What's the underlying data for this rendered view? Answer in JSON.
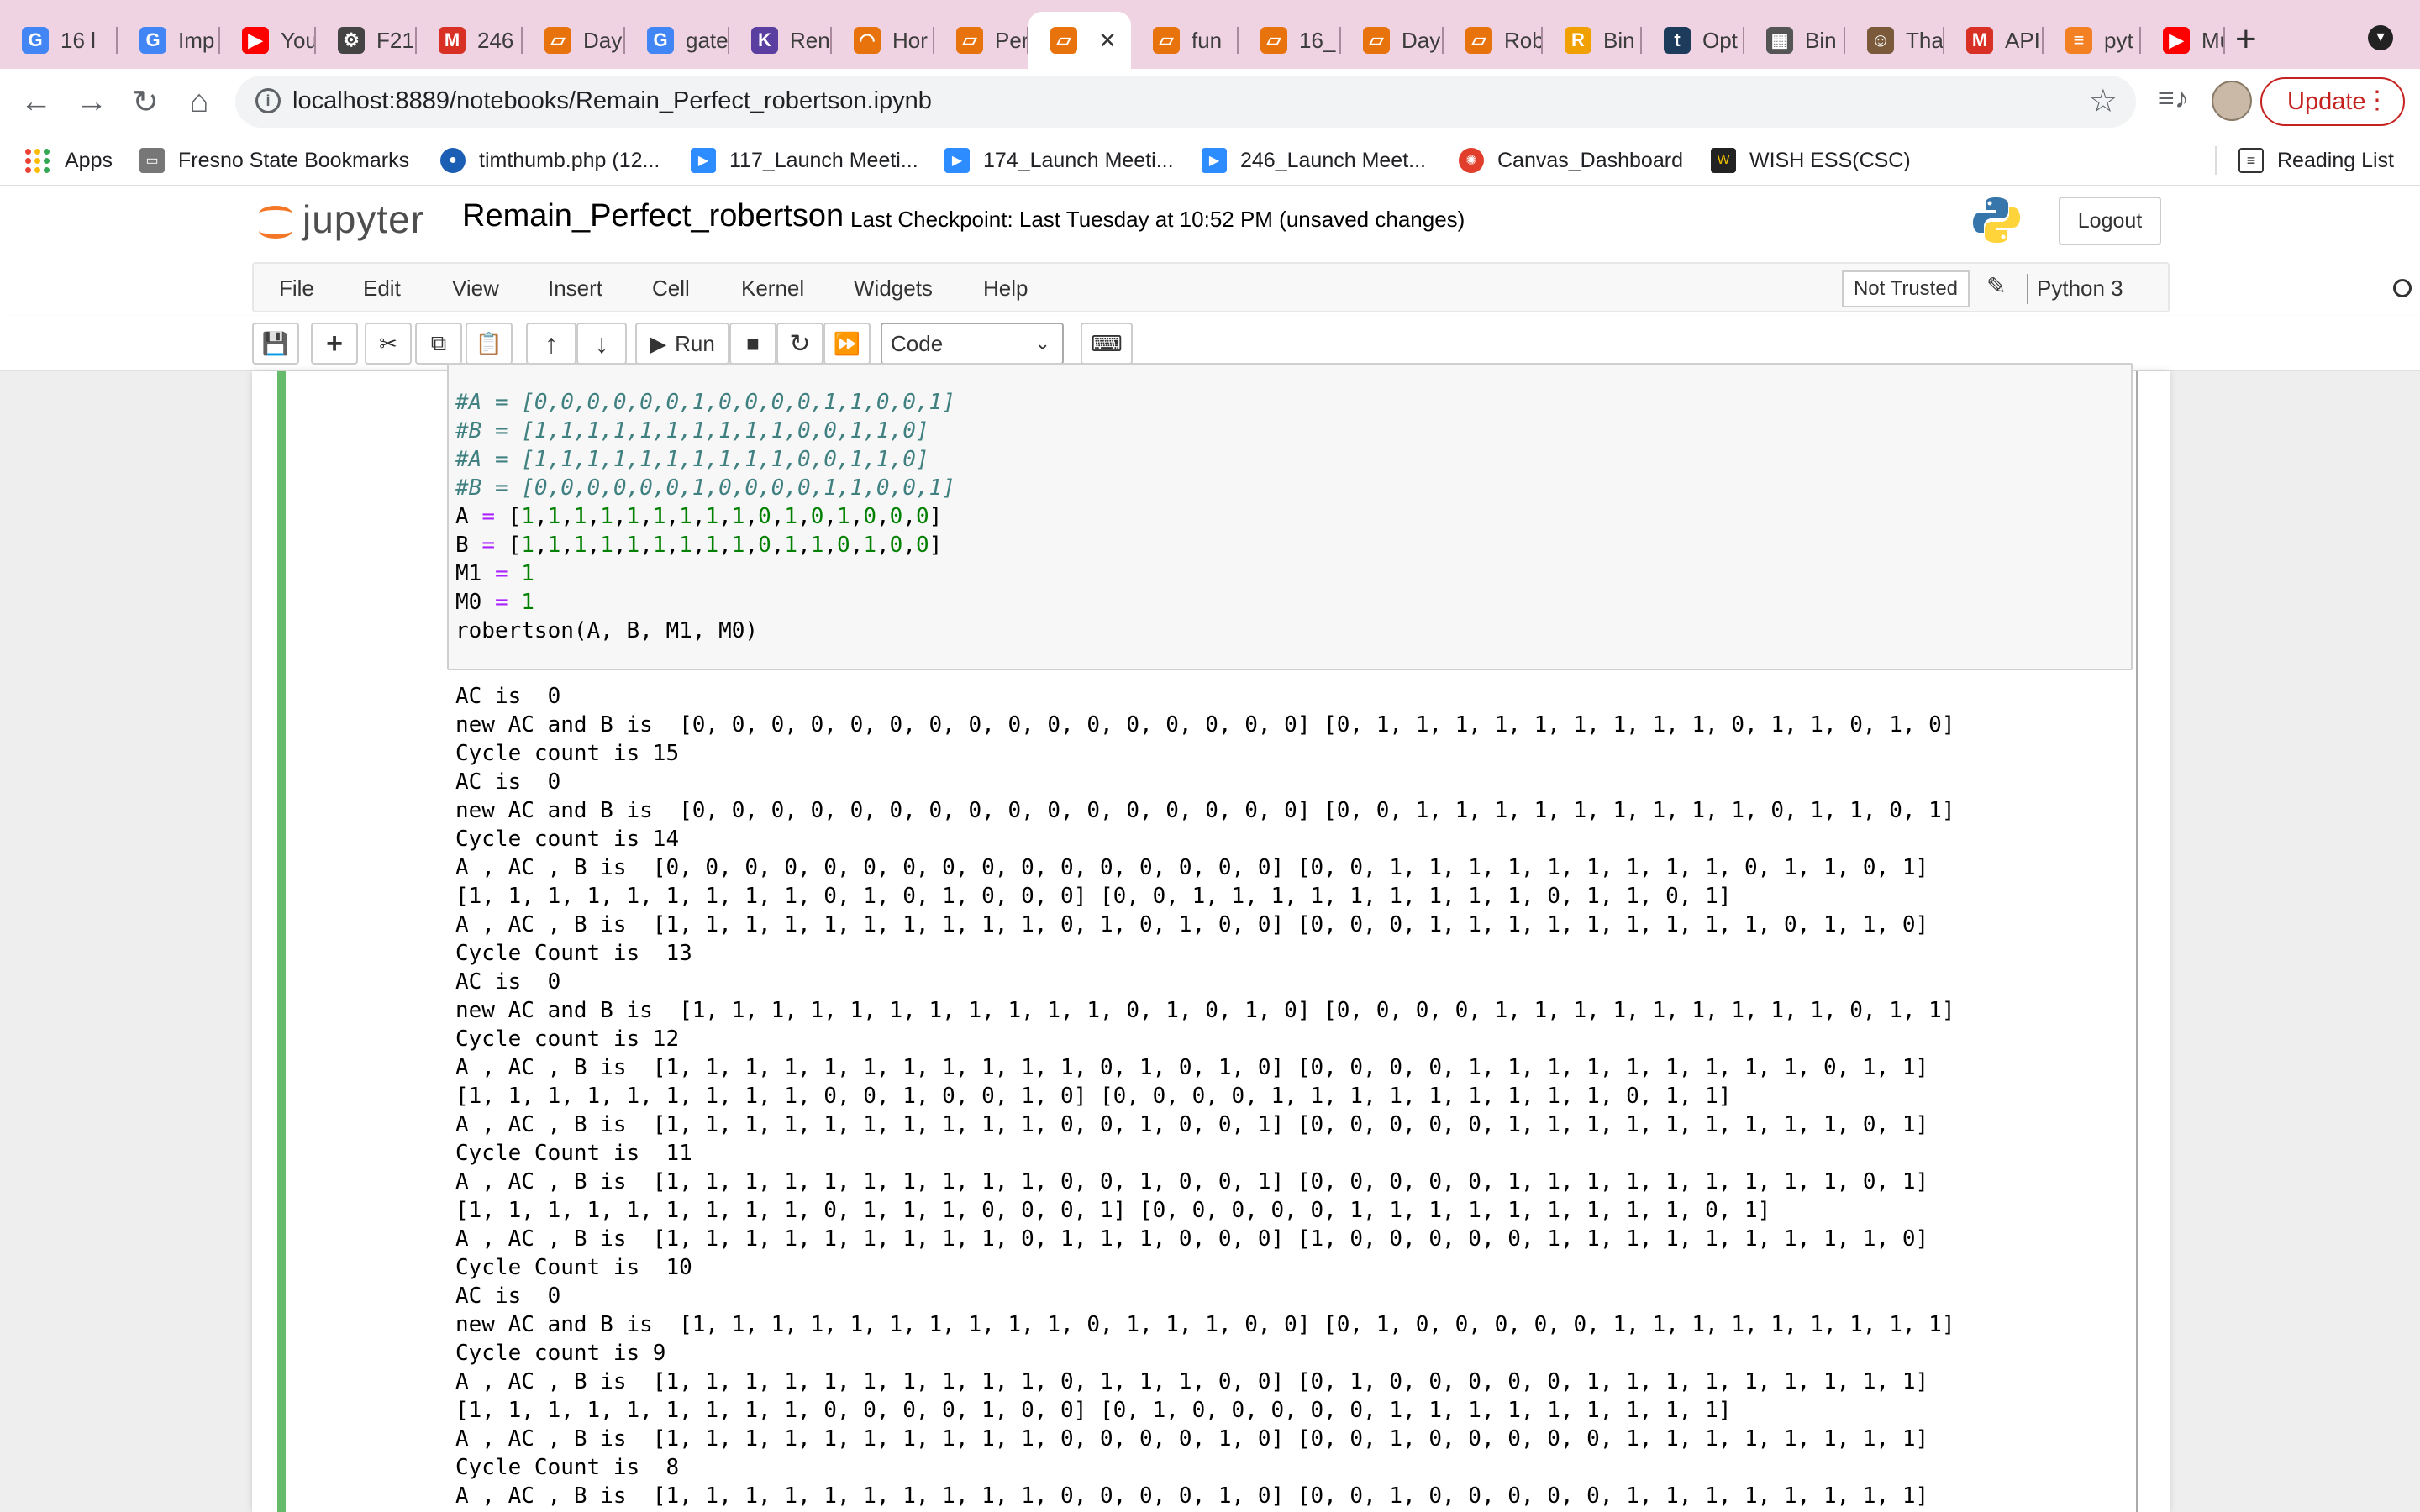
{
  "browser": {
    "tabs": [
      {
        "label": "16 l",
        "icon": "google-icon",
        "color": "#4285f4",
        "glyph": "G"
      },
      {
        "label": "Imp",
        "icon": "google-icon",
        "color": "#4285f4",
        "glyph": "G"
      },
      {
        "label": "You",
        "icon": "youtube-icon",
        "color": "#ff0000",
        "glyph": "▶"
      },
      {
        "label": "F21",
        "icon": "atom-icon",
        "color": "#444444",
        "glyph": "⚙"
      },
      {
        "label": "246",
        "icon": "gmail-icon",
        "color": "#d93025",
        "glyph": "M"
      },
      {
        "label": "Day",
        "icon": "book-icon",
        "color": "#e8730c",
        "glyph": "▱"
      },
      {
        "label": "gate",
        "icon": "google-icon",
        "color": "#4285f4",
        "glyph": "G"
      },
      {
        "label": "Ren",
        "icon": "kp-icon",
        "color": "#5a3fa0",
        "glyph": "K"
      },
      {
        "label": "Hor",
        "icon": "loading-icon",
        "color": "#e8730c",
        "glyph": "◠"
      },
      {
        "label": "Per",
        "icon": "book-icon",
        "color": "#e8730c",
        "glyph": "▱"
      },
      {
        "label": "",
        "icon": "book-icon",
        "color": "#e8730c",
        "glyph": "▱"
      },
      {
        "label": "fun",
        "icon": "book-icon",
        "color": "#e8730c",
        "glyph": "▱"
      },
      {
        "label": "16_",
        "icon": "book-icon",
        "color": "#e8730c",
        "glyph": "▱"
      },
      {
        "label": "Day",
        "icon": "book-icon",
        "color": "#e8730c",
        "glyph": "▱"
      },
      {
        "label": "Rob",
        "icon": "book-icon",
        "color": "#e8730c",
        "glyph": "▱"
      },
      {
        "label": "Bin",
        "icon": "r-icon",
        "color": "#f0a000",
        "glyph": "R"
      },
      {
        "label": "Opt",
        "icon": "tds-icon",
        "color": "#1d3c5c",
        "glyph": "t"
      },
      {
        "label": "Bin",
        "icon": "calculator-icon",
        "color": "#555555",
        "glyph": "▦"
      },
      {
        "label": "Tha",
        "icon": "avatar-icon",
        "color": "#7a5a3a",
        "glyph": "☺"
      },
      {
        "label": "API",
        "icon": "gmail-icon",
        "color": "#d93025",
        "glyph": "M"
      },
      {
        "label": "pyt",
        "icon": "stack-icon",
        "color": "#f48024",
        "glyph": "≡"
      },
      {
        "label": "Mu",
        "icon": "youtube-icon",
        "color": "#ff0000",
        "glyph": "▶"
      }
    ],
    "url": "localhost:8889/notebooks/Remain_Perfect_robertson.ipynb",
    "update_label": "Update",
    "bookmarks": [
      {
        "label": "Apps",
        "icon": "apps-grid-icon"
      },
      {
        "label": "Fresno State Bookmarks",
        "icon": "folder-icon"
      },
      {
        "label": "timthumb.php (12...",
        "icon": "globe-icon"
      },
      {
        "label": "117_Launch Meeti...",
        "icon": "zoom-icon"
      },
      {
        "label": "174_Launch Meeti...",
        "icon": "zoom-icon"
      },
      {
        "label": "246_Launch Meet...",
        "icon": "zoom-icon"
      },
      {
        "label": "Canvas_Dashboard",
        "icon": "canvas-icon"
      },
      {
        "label": "WISH ESS(CSC)",
        "icon": "wish-icon"
      }
    ],
    "reading_list": "Reading List"
  },
  "jupyter": {
    "logo_text": "jupyter",
    "notebook_name": "Remain_Perfect_robertson",
    "checkpoint": "Last Checkpoint: Last Tuesday at 10:52 PM  (unsaved changes)",
    "logout": "Logout",
    "menus": [
      "File",
      "Edit",
      "View",
      "Insert",
      "Cell",
      "Kernel",
      "Widgets",
      "Help"
    ],
    "trust": "Not Trusted",
    "kernel": "Python 3",
    "run_label": "Run",
    "cell_type": "Code"
  },
  "cell": {
    "code_lines": [
      {
        "text": "#A = [0,0,0,0,0,0,1,0,0,0,0,1,1,0,0,1]",
        "kind": "comment"
      },
      {
        "text": "#B = [1,1,1,1,1,1,1,1,1,1,0,0,1,1,0]",
        "kind": "comment"
      },
      {
        "text": "#A = [1,1,1,1,1,1,1,1,1,1,0,0,1,1,0]",
        "kind": "comment"
      },
      {
        "text": "#B = [0,0,0,0,0,0,1,0,0,0,0,1,1,0,0,1]",
        "kind": "comment"
      },
      {
        "text": "A = [1,1,1,1,1,1,1,1,1,0,1,0,1,0,0,0]",
        "kind": "assign"
      },
      {
        "text": "B = [1,1,1,1,1,1,1,1,1,0,1,1,0,1,0,0]",
        "kind": "assign"
      },
      {
        "text": "M1 = 1",
        "kind": "assign"
      },
      {
        "text": "M0 = 1",
        "kind": "assign"
      },
      {
        "text": "robertson(A, B, M1, M0)",
        "kind": "plain"
      }
    ],
    "output_lines": [
      "AC is  0",
      "new AC and B is  [0, 0, 0, 0, 0, 0, 0, 0, 0, 0, 0, 0, 0, 0, 0, 0] [0, 1, 1, 1, 1, 1, 1, 1, 1, 1, 0, 1, 1, 0, 1, 0]",
      "Cycle count is 15",
      "AC is  0",
      "new AC and B is  [0, 0, 0, 0, 0, 0, 0, 0, 0, 0, 0, 0, 0, 0, 0, 0] [0, 0, 1, 1, 1, 1, 1, 1, 1, 1, 1, 0, 1, 1, 0, 1]",
      "Cycle count is 14",
      "A , AC , B is  [0, 0, 0, 0, 0, 0, 0, 0, 0, 0, 0, 0, 0, 0, 0, 0] [0, 0, 1, 1, 1, 1, 1, 1, 1, 1, 1, 0, 1, 1, 0, 1]",
      "[1, 1, 1, 1, 1, 1, 1, 1, 1, 0, 1, 0, 1, 0, 0, 0] [0, 0, 1, 1, 1, 1, 1, 1, 1, 1, 1, 0, 1, 1, 0, 1]",
      "A , AC , B is  [1, 1, 1, 1, 1, 1, 1, 1, 1, 1, 0, 1, 0, 1, 0, 0] [0, 0, 0, 1, 1, 1, 1, 1, 1, 1, 1, 1, 0, 1, 1, 0]",
      "Cycle Count is  13",
      "AC is  0",
      "new AC and B is  [1, 1, 1, 1, 1, 1, 1, 1, 1, 1, 1, 0, 1, 0, 1, 0] [0, 0, 0, 0, 1, 1, 1, 1, 1, 1, 1, 1, 1, 0, 1, 1]",
      "Cycle count is 12",
      "A , AC , B is  [1, 1, 1, 1, 1, 1, 1, 1, 1, 1, 1, 0, 1, 0, 1, 0] [0, 0, 0, 0, 1, 1, 1, 1, 1, 1, 1, 1, 1, 0, 1, 1]",
      "[1, 1, 1, 1, 1, 1, 1, 1, 1, 0, 0, 1, 0, 0, 1, 0] [0, 0, 0, 0, 1, 1, 1, 1, 1, 1, 1, 1, 1, 0, 1, 1]",
      "A , AC , B is  [1, 1, 1, 1, 1, 1, 1, 1, 1, 1, 0, 0, 1, 0, 0, 1] [0, 0, 0, 0, 0, 1, 1, 1, 1, 1, 1, 1, 1, 1, 0, 1]",
      "Cycle Count is  11",
      "A , AC , B is  [1, 1, 1, 1, 1, 1, 1, 1, 1, 1, 0, 0, 1, 0, 0, 1] [0, 0, 0, 0, 0, 1, 1, 1, 1, 1, 1, 1, 1, 1, 0, 1]",
      "[1, 1, 1, 1, 1, 1, 1, 1, 1, 0, 1, 1, 1, 0, 0, 0, 1] [0, 0, 0, 0, 0, 1, 1, 1, 1, 1, 1, 1, 1, 1, 0, 1]",
      "A , AC , B is  [1, 1, 1, 1, 1, 1, 1, 1, 1, 0, 1, 1, 1, 0, 0, 0] [1, 0, 0, 0, 0, 0, 1, 1, 1, 1, 1, 1, 1, 1, 1, 0]",
      "Cycle Count is  10",
      "AC is  0",
      "new AC and B is  [1, 1, 1, 1, 1, 1, 1, 1, 1, 1, 0, 1, 1, 1, 0, 0] [0, 1, 0, 0, 0, 0, 0, 1, 1, 1, 1, 1, 1, 1, 1, 1]",
      "Cycle count is 9",
      "A , AC , B is  [1, 1, 1, 1, 1, 1, 1, 1, 1, 1, 0, 1, 1, 1, 0, 0] [0, 1, 0, 0, 0, 0, 0, 1, 1, 1, 1, 1, 1, 1, 1, 1]",
      "[1, 1, 1, 1, 1, 1, 1, 1, 1, 0, 0, 0, 0, 1, 0, 0] [0, 1, 0, 0, 0, 0, 0, 1, 1, 1, 1, 1, 1, 1, 1, 1]",
      "A , AC , B is  [1, 1, 1, 1, 1, 1, 1, 1, 1, 1, 0, 0, 0, 0, 1, 0] [0, 0, 1, 0, 0, 0, 0, 0, 1, 1, 1, 1, 1, 1, 1, 1]",
      "Cycle Count is  8",
      "A , AC , B is  [1, 1, 1, 1, 1, 1, 1, 1, 1, 1, 0, 0, 0, 0, 1, 0] [0, 0, 1, 0, 0, 0, 0, 0, 1, 1, 1, 1, 1, 1, 1, 1]"
    ]
  }
}
